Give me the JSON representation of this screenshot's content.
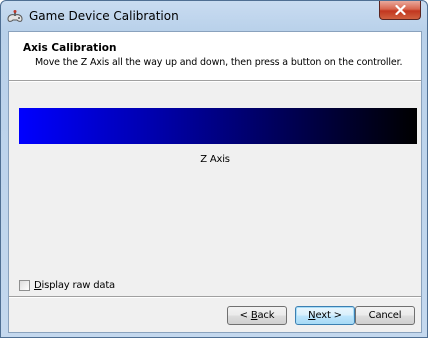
{
  "window": {
    "title": "Game Device Calibration"
  },
  "header": {
    "title": "Axis Calibration",
    "subtitle": "Move the Z Axis all the way up and down, then press a button on the controller."
  },
  "axis": {
    "label": "Z Axis",
    "bar_colors": [
      "#0000ff",
      "#000000"
    ]
  },
  "options": {
    "raw_data": {
      "mnemonic": "D",
      "rest": "isplay raw data",
      "checked": false
    }
  },
  "buttons": {
    "back": {
      "prefix": "< ",
      "mnemonic": "B",
      "rest": "ack"
    },
    "next": {
      "mnemonic": "N",
      "rest": "ext >"
    },
    "cancel": {
      "label": "Cancel"
    }
  },
  "icons": {
    "title": "joystick-icon",
    "close": "close-icon"
  }
}
